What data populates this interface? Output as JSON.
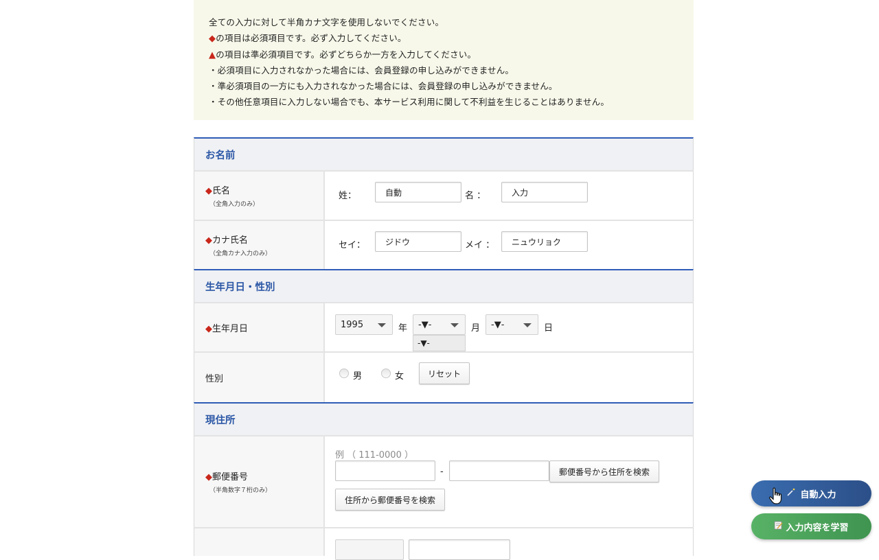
{
  "notice": {
    "lines": [
      "全ての入力に対して半角カナ文字を使用しないでください。",
      "の項目は必須項目です。必ず入力してください。",
      "の項目は準必須項目です。必ずどちらか一方を入力してください。",
      "・必須項目に入力されなかった場合には、会員登録の申し込みができません。",
      "・準必須項目の一方にも入力されなかった場合には、会員登録の申し込みができません。",
      "・その他任意項目に入力しない場合でも、本サービス利用に関して不利益を生じることはありません。"
    ],
    "required_marker": "◆",
    "semi_required_marker": "▲",
    "marker_color": "#c9271b",
    "background_color": "#f7f8ea"
  },
  "sections": {
    "name": {
      "title": "お名前",
      "full_name": {
        "marker": "◆",
        "label": "氏名",
        "note": "（全角入力のみ）",
        "last_label": "姓：",
        "last_value": "自動",
        "first_label": "名 ：",
        "first_value": "入力"
      },
      "kana_name": {
        "marker": "◆",
        "label": "カナ氏名",
        "note": "（全角カナ入力のみ）",
        "last_label": "セイ：",
        "last_value": "ジドウ",
        "first_label": "メイ ：",
        "first_value": "ニュウリョク"
      }
    },
    "birth_gender": {
      "title": "生年月日・性別",
      "birthdate": {
        "marker": "◆",
        "label": "生年月日",
        "year_value": "1995",
        "year_unit": "年",
        "month_value": "-▼-",
        "month_unit": "月",
        "day_value": "-▼-",
        "day_unit": "日",
        "month_dropdown_option": "-▼-"
      },
      "gender": {
        "label": "性別",
        "male": "男",
        "female": "女",
        "reset_button": "リセット"
      }
    },
    "address": {
      "title": "現住所",
      "postal": {
        "marker": "◆",
        "label": "郵便番号",
        "note": "（半角数字７桁のみ）",
        "example": "例 （ 111-0000 ）",
        "dash": "-",
        "search_by_postal": "郵便番号から住所を検索",
        "search_by_address": "住所から郵便番号を検索"
      }
    }
  },
  "floating": {
    "autofill_label": "自動入力",
    "autofill_icon": "magic-wand-icon",
    "learn_label": "入力内容を学習",
    "learn_icon": "memo-icon",
    "autofill_color": "#2f5e9e",
    "learn_color": "#4aa15a"
  },
  "colors": {
    "accent": "#2f5cb7",
    "section_title": "#2b57a6"
  }
}
